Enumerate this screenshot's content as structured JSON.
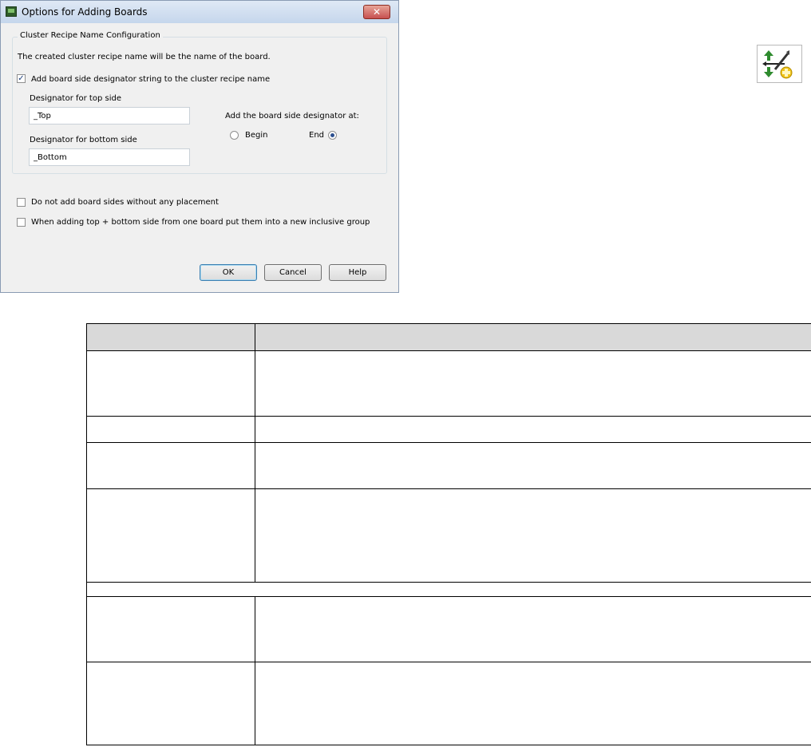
{
  "dialog": {
    "title": "Options for Adding Boards",
    "close_label": "✕",
    "group_title": "Cluster Recipe Name Configuration",
    "info_text": "The created cluster recipe name will be the name of the board.",
    "add_designator_label": "Add board side designator string to the cluster recipe name",
    "add_designator_checked": true,
    "top_label": "Designator for top side",
    "top_value": "_Top",
    "bottom_label": "Designator for bottom side",
    "bottom_value": "_Bottom",
    "position_label": "Add the board side designator at:",
    "begin_label": "Begin",
    "end_label": "End",
    "selected_position": "End",
    "no_placement_label": "Do not add board sides without any placement",
    "no_placement_checked": false,
    "inclusive_group_label": "When adding top + bottom side from one board put them into a new inclusive group",
    "inclusive_group_checked": false,
    "ok_label": "OK",
    "cancel_label": "Cancel",
    "help_label": "Help"
  },
  "toolbar_icon": "add-boards-icon",
  "colors": {
    "dialog_bg": "#f0f0f0",
    "title_gradient_top": "#dfe9f5",
    "close_red": "#c75050",
    "table_header_bg": "#d9d9d9"
  }
}
